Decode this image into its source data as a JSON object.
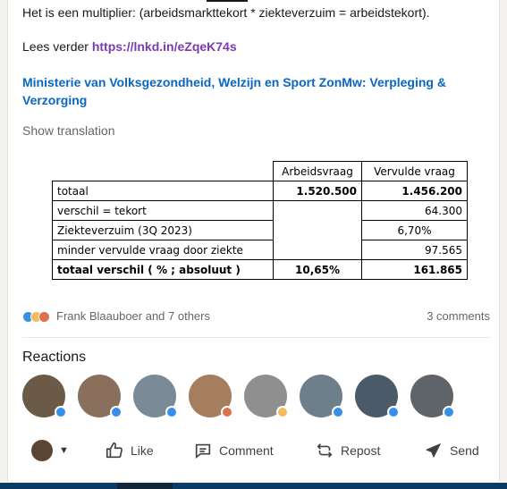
{
  "post": {
    "text_line1": "Het is een multiplier: (arbeidsmarkttekort * ziekteverzuim = arbeidstekort).",
    "read_more_prefix": "Lees verder ",
    "read_more_link": "https://lnkd.in/eZqeK74s",
    "source_link": "Ministerie van Volksgezondheid, Welzijn en Sport ZonMw: Verpleging & Verzorging",
    "show_translation": "Show translation"
  },
  "table": {
    "headers": [
      "",
      "Arbeidsvraag",
      "Vervulde vraag"
    ],
    "rows": [
      [
        "totaal",
        "1.520.500",
        "1.456.200"
      ],
      [
        "verschil = tekort",
        "",
        "64.300"
      ],
      [
        "Ziekteverzuim (3Q 2023)",
        "",
        "6,70%"
      ],
      [
        "minder vervulde vraag door ziekte",
        "",
        "97.565"
      ],
      [
        "totaal verschil ( % ; absoluut )",
        "10,65%",
        "161.865"
      ]
    ]
  },
  "social": {
    "names": "Frank Blaauboer and 7 others",
    "comments": "3 comments",
    "reaction_icons": [
      "like-icon",
      "celebrate-icon",
      "love-icon"
    ]
  },
  "reactions": {
    "title": "Reactions",
    "avatars": [
      {
        "badge": "like",
        "color": "#6b5a48"
      },
      {
        "badge": "like",
        "color": "#8a6f5c"
      },
      {
        "badge": "like",
        "color": "#7a8a96"
      },
      {
        "badge": "love",
        "color": "#a57d5f"
      },
      {
        "badge": "idea",
        "color": "#8f8f8f"
      },
      {
        "badge": "like",
        "color": "#6e7f8c"
      },
      {
        "badge": "like",
        "color": "#4b5a68"
      },
      {
        "badge": "like",
        "color": "#5f646b"
      }
    ]
  },
  "actions": {
    "like": "Like",
    "comment": "Comment",
    "repost": "Repost",
    "send": "Send"
  },
  "colors": {
    "link_purple": "#7c3ab1",
    "link_blue": "#0a66c2",
    "muted_text": "#666666"
  }
}
